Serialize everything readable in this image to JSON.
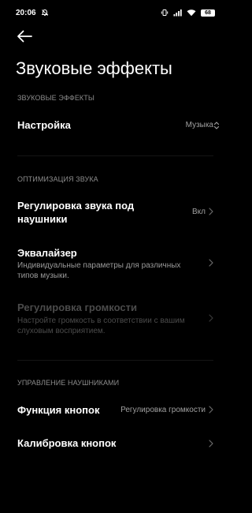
{
  "status_bar": {
    "time": "20:06",
    "battery": "68",
    "icons": [
      "alarm-off-icon",
      "vibrate-icon",
      "signal-icon",
      "wifi-icon",
      "battery-icon"
    ]
  },
  "header": {
    "back_icon": "arrow-left-icon",
    "title": "Звуковые эффекты"
  },
  "sections": [
    {
      "header": "ЗВУКОВЫЕ ЭФФЕКТЫ",
      "items": [
        {
          "title": "Настройка",
          "value": "Музыка",
          "control_icon": "up-down-chevron-icon"
        }
      ]
    },
    {
      "header": "ОПТИМИЗАЦИЯ ЗВУКА",
      "items": [
        {
          "title": "Регулировка звука под наушники",
          "value": "Вкл",
          "control_icon": "chevron-right-icon"
        },
        {
          "title": "Эквалайзер",
          "subtitle": "Индивидуальные параметры для различных типов музыки.",
          "control_icon": "chevron-right-icon"
        },
        {
          "title": "Регулировка громкости",
          "subtitle": "Настройте громкость в соответствии с вашим слуховым восприятием.",
          "control_icon": "chevron-right-icon",
          "disabled": true
        }
      ]
    },
    {
      "header": "УПРАВЛЕНИЕ НАУШНИКАМИ",
      "items": [
        {
          "title": "Функция кнопок",
          "value": "Регулировка громкости",
          "control_icon": "chevron-right-icon"
        },
        {
          "title": "Калибровка кнопок",
          "control_icon": "chevron-right-icon"
        }
      ]
    }
  ],
  "colors": {
    "background": "#000000",
    "text_primary": "#ffffff",
    "text_secondary": "#9a9a9a",
    "text_disabled": "#4b4b4b"
  }
}
